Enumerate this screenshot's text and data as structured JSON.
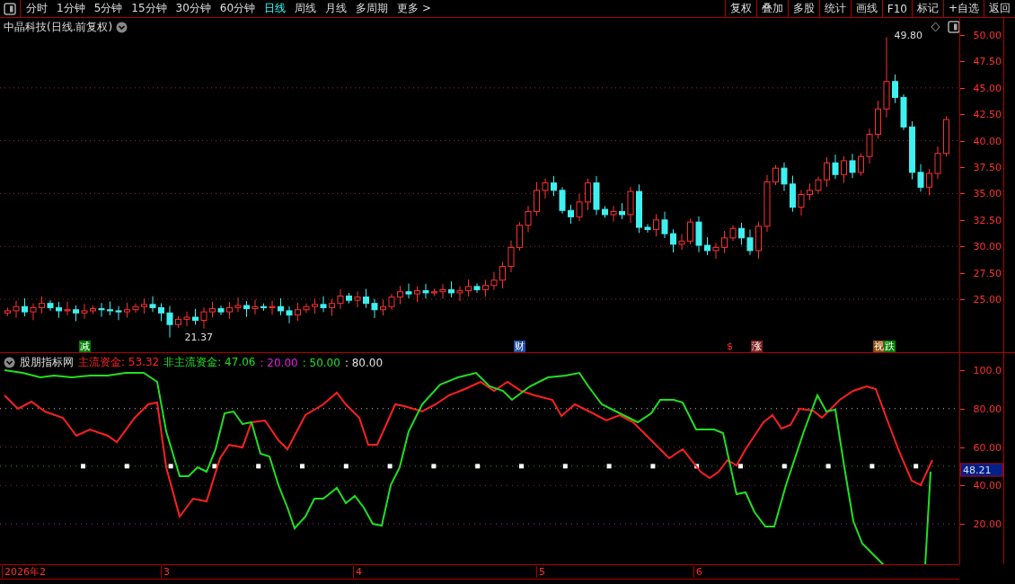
{
  "toolbar": {
    "periods": [
      {
        "label": "分时",
        "selected": false
      },
      {
        "label": "1分钟",
        "selected": false
      },
      {
        "label": "5分钟",
        "selected": false
      },
      {
        "label": "15分钟",
        "selected": false
      },
      {
        "label": "30分钟",
        "selected": false
      },
      {
        "label": "60分钟",
        "selected": false
      },
      {
        "label": "日线",
        "selected": true
      },
      {
        "label": "周线",
        "selected": false
      },
      {
        "label": "月线",
        "selected": false
      },
      {
        "label": "多周期",
        "selected": false
      },
      {
        "label": "更多 >",
        "selected": false
      }
    ],
    "buttons": [
      "复权",
      "叠加",
      "多股",
      "统计",
      "画线",
      "F10",
      "标记",
      "+自选",
      "返回"
    ]
  },
  "price_chart": {
    "title": "中晶科技(日线.前复权)",
    "high_label": "49.80",
    "low_label": "21.37",
    "ticks": [
      "50.00",
      "47.50",
      "45.00",
      "42.50",
      "40.00",
      "37.50",
      "35.00",
      "32.50",
      "30.00",
      "27.50",
      "25.00"
    ],
    "events": [
      {
        "label": "减",
        "color": "#007f00"
      },
      {
        "label": "财",
        "color": "#1f4fa0"
      },
      {
        "label": "$",
        "color": "#000000"
      },
      {
        "label": "涨",
        "color": "#7f1f1f"
      },
      {
        "label": "视",
        "color": "#8a4a00"
      },
      {
        "label": "跌",
        "color": "#007f00"
      }
    ]
  },
  "indicator": {
    "name": "股朋指标网",
    "legend": [
      {
        "label": "主流资金:",
        "value": "53.32",
        "color": "#ff2020"
      },
      {
        "label": "非主流资金:",
        "value": "47.06",
        "color": "#20e020"
      },
      {
        "label": ":",
        "value": "20.00",
        "color": "#e020e0"
      },
      {
        "label": ":",
        "value": "50.00",
        "color": "#20e020"
      },
      {
        "label": ":",
        "value": "80.00",
        "color": "#e0e0e0"
      }
    ],
    "ticks": [
      "100.0",
      "80.00",
      "60.00",
      "40.00",
      "20.00"
    ],
    "current_value": "48.21"
  },
  "date_axis": [
    "2026年2",
    "3",
    "4",
    "5",
    "6"
  ]
}
